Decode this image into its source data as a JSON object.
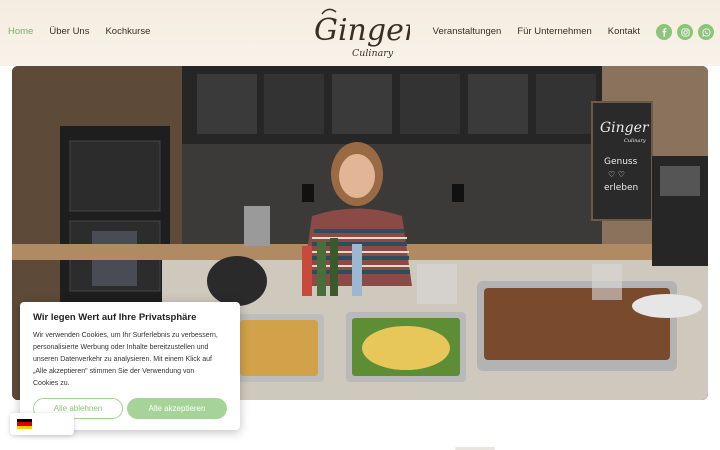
{
  "nav": {
    "left": [
      {
        "label": "Home",
        "active": true
      },
      {
        "label": "Über Uns",
        "active": false
      },
      {
        "label": "Kochkurse",
        "active": false
      }
    ],
    "right": [
      {
        "label": "Veranstaltungen"
      },
      {
        "label": "Für Unternehmen"
      },
      {
        "label": "Kontakt"
      }
    ]
  },
  "logo": {
    "main": "Ginger",
    "sub": "Culinary"
  },
  "social": [
    "facebook-icon",
    "instagram-icon",
    "whatsapp-icon"
  ],
  "colors": {
    "accent": "#8bc47a",
    "accent_light": "#a6d397",
    "nav_active": "#7fae6b",
    "header_bg": "#f4ecdf"
  },
  "hero": {
    "chalkboard": {
      "logo_main": "Ginger",
      "logo_sub": "Culinary",
      "line1": "Genuss",
      "line2": "♡ ♡",
      "line3": "erleben"
    }
  },
  "cookie": {
    "title": "Wir legen Wert auf Ihre Privatsphäre",
    "lines": [
      "Wir verwenden Cookies, um Ihr Surferlebnis zu verbessern,",
      "personalisierte Werbung oder Inhalte bereitzustellen und",
      "unseren Datenverkehr zu analysieren. Mit einem Klick auf",
      "„Alle akzeptieren\" stimmen Sie der Verwendung von",
      "Cookies zu."
    ],
    "decline": "Alle ablehnen",
    "accept": "Alle akzeptieren"
  },
  "language": {
    "flag": "de-flag-icon",
    "colors": [
      "#000000",
      "#dd0000",
      "#ffce00"
    ]
  }
}
